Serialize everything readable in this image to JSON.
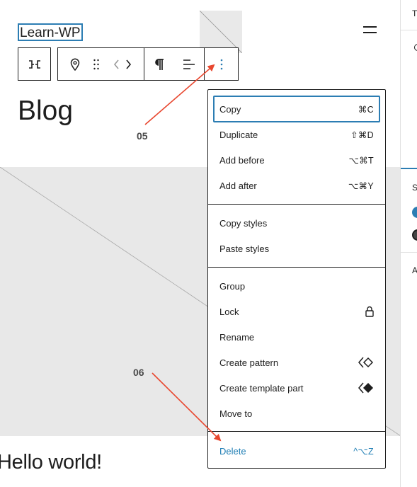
{
  "site": {
    "title": "Learn-WP"
  },
  "page": {
    "heading": "Blog",
    "post_title": "Hello world!"
  },
  "annotations": {
    "step_1": "05",
    "step_2": "06"
  },
  "toolbar": {
    "buttons": [
      "parent-block",
      "location",
      "drag-handle",
      "move-left-right",
      "paragraph",
      "align",
      "options"
    ]
  },
  "menu": {
    "section_1": [
      {
        "label": "Copy",
        "shortcut": "⌘C"
      },
      {
        "label": "Duplicate",
        "shortcut": "⇧⌘D"
      },
      {
        "label": "Add before",
        "shortcut": "⌥⌘T"
      },
      {
        "label": "Add after",
        "shortcut": "⌥⌘Y"
      }
    ],
    "section_2": [
      {
        "label": "Copy styles"
      },
      {
        "label": "Paste styles"
      }
    ],
    "section_3": [
      {
        "label": "Group"
      },
      {
        "label": "Lock",
        "icon": "lock-icon"
      },
      {
        "label": "Rename"
      },
      {
        "label": "Create pattern",
        "icon": "pattern-icon"
      },
      {
        "label": "Create template part",
        "icon": "template-part-icon"
      },
      {
        "label": "Move to"
      }
    ],
    "delete": {
      "label": "Delete",
      "shortcut": "^⌥Z"
    }
  },
  "sidebar": {
    "tab_initial": "T",
    "section_initial": "S",
    "advanced_initial": "A"
  },
  "colors": {
    "accent": "#2c7db3",
    "arrow": "#e8472f",
    "placeholder": "#e8e8e8"
  }
}
